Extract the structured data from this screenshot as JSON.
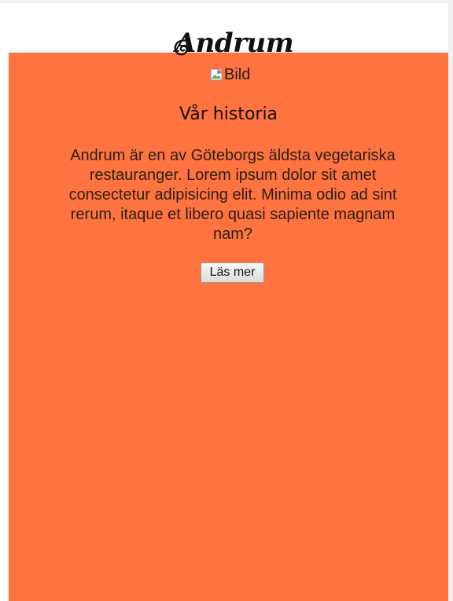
{
  "header": {
    "logo_text": "Andrum"
  },
  "hero": {
    "image_alt": "Bild",
    "image_icon": "broken-image-icon"
  },
  "story": {
    "title": "Vår historia",
    "body": "Andrum är en av Göteborgs äldsta vegetariska restauranger. Lorem ipsum dolor sit amet consectetur adipisicing elit. Minima odio ad sint rerum, itaque et libero quasi sapiente magnam nam?",
    "button_label": "Läs mer"
  },
  "colors": {
    "accent": "#ff7340",
    "page_background": "#ffffff",
    "text": "#111111"
  }
}
